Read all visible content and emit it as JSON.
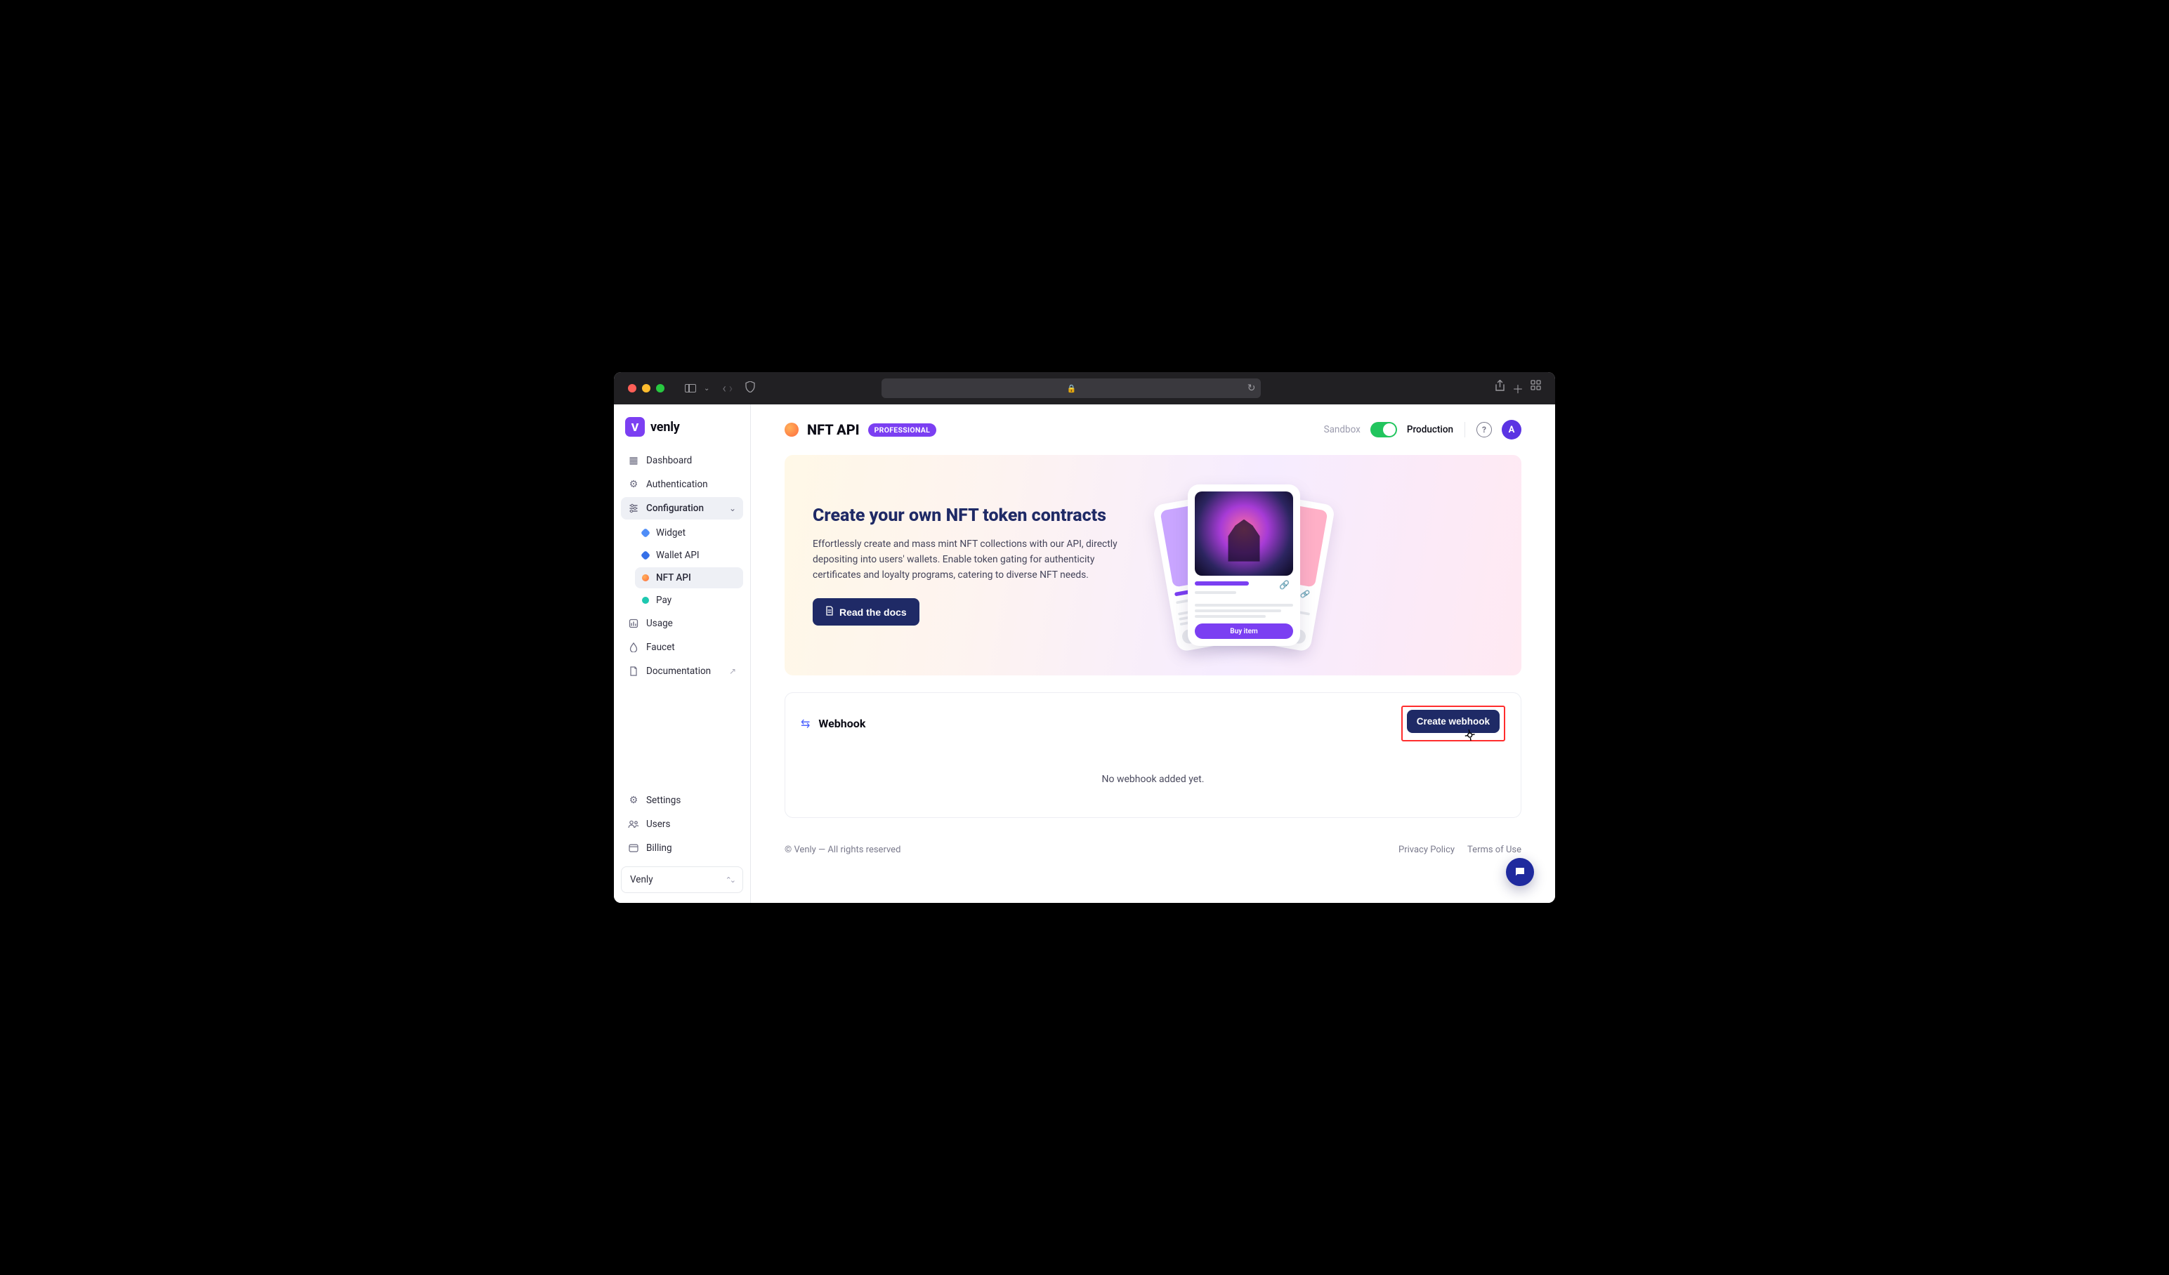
{
  "brand": {
    "name": "venly",
    "mark": "V"
  },
  "sidebar": {
    "main": [
      {
        "id": "dashboard",
        "label": "Dashboard"
      },
      {
        "id": "authentication",
        "label": "Authentication"
      }
    ],
    "config_label": "Configuration",
    "config_items": [
      {
        "id": "widget",
        "label": "Widget"
      },
      {
        "id": "wallet-api",
        "label": "Wallet API"
      },
      {
        "id": "nft-api",
        "label": "NFT API"
      },
      {
        "id": "pay",
        "label": "Pay"
      }
    ],
    "after": [
      {
        "id": "usage",
        "label": "Usage"
      },
      {
        "id": "faucet",
        "label": "Faucet"
      },
      {
        "id": "documentation",
        "label": "Documentation",
        "external": true
      }
    ],
    "bottom": [
      {
        "id": "settings",
        "label": "Settings"
      },
      {
        "id": "users",
        "label": "Users"
      },
      {
        "id": "billing",
        "label": "Billing"
      }
    ],
    "org": "Venly"
  },
  "topbar": {
    "title": "NFT API",
    "plan_badge": "PROFESSIONAL",
    "env_left": "Sandbox",
    "env_right": "Production",
    "avatar_initial": "A"
  },
  "hero": {
    "title": "Create your own NFT token contracts",
    "desc": "Effortlessly create and mass mint NFT collections with our API, directly depositing into users' wallets. Enable token gating for authenticity certificates and loyalty programs, catering to diverse NFT needs.",
    "cta": "Read the docs",
    "card_buy_label": "Buy item"
  },
  "webhook": {
    "section_title": "Webhook",
    "create_label": "Create webhook",
    "empty_state": "No webhook added yet."
  },
  "footer": {
    "copyright": "© Venly — All rights reserved",
    "link_privacy": "Privacy Policy",
    "link_terms": "Terms of Use"
  }
}
